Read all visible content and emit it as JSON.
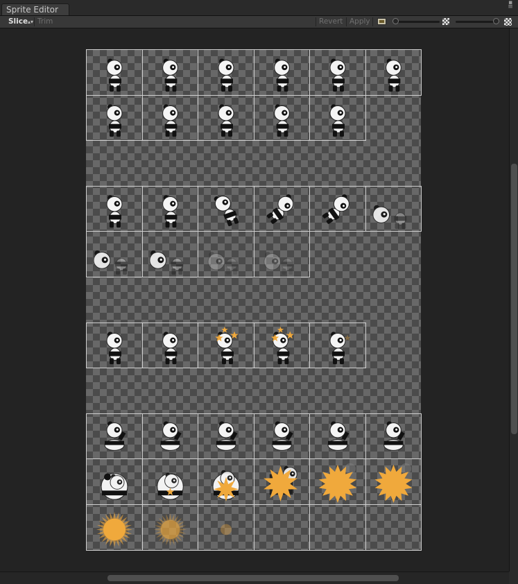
{
  "window": {
    "tab_title": "Sprite Editor"
  },
  "toolbar": {
    "slice_label": "Slice",
    "slice_dropdown_icon": "up-down-arrows-icon",
    "trim_label": "Trim",
    "revert_label": "Revert",
    "apply_label": "Apply",
    "channel_icon": "rgb-channel-icon",
    "mip_small_icon": "mip-small-icon",
    "mip_large_icon": "mip-large-icon"
  },
  "colors": {
    "window_bg": "#151515",
    "toolbar_bg": "#383838",
    "viewport_bg": "#232323",
    "checker_dark": "#4b4b4b",
    "checker_light": "#686868",
    "frame_border": "#d0d0d0",
    "star_orange": "#f0a93c"
  },
  "sprite_sheet": {
    "sprites": [
      {
        "row": 0,
        "col": 0,
        "kind": "panda-walk"
      },
      {
        "row": 0,
        "col": 1,
        "kind": "panda-walk"
      },
      {
        "row": 0,
        "col": 2,
        "kind": "panda-walk"
      },
      {
        "row": 0,
        "col": 3,
        "kind": "panda-walk"
      },
      {
        "row": 0,
        "col": 4,
        "kind": "panda-walk"
      },
      {
        "row": 0,
        "col": 5,
        "kind": "panda-walk"
      },
      {
        "row": 1,
        "col": 0,
        "kind": "panda-walk"
      },
      {
        "row": 1,
        "col": 1,
        "kind": "panda-walk"
      },
      {
        "row": 1,
        "col": 2,
        "kind": "panda-walk"
      },
      {
        "row": 1,
        "col": 3,
        "kind": "panda-walk"
      },
      {
        "row": 1,
        "col": 4,
        "kind": "panda-walk"
      },
      {
        "row": 3,
        "col": 0,
        "kind": "panda-walk"
      },
      {
        "row": 3,
        "col": 1,
        "kind": "panda-walk"
      },
      {
        "row": 3,
        "col": 2,
        "kind": "panda-tilt"
      },
      {
        "row": 3,
        "col": 3,
        "kind": "panda-fall"
      },
      {
        "row": 3,
        "col": 4,
        "kind": "panda-fall"
      },
      {
        "row": 3,
        "col": 5,
        "kind": "panda-fade"
      },
      {
        "row": 4,
        "col": 0,
        "kind": "panda-fade"
      },
      {
        "row": 4,
        "col": 1,
        "kind": "panda-fade"
      },
      {
        "row": 4,
        "col": 2,
        "kind": "panda-faint"
      },
      {
        "row": 4,
        "col": 3,
        "kind": "panda-faint"
      },
      {
        "row": 6,
        "col": 0,
        "kind": "panda-walk"
      },
      {
        "row": 6,
        "col": 1,
        "kind": "panda-walk"
      },
      {
        "row": 6,
        "col": 2,
        "kind": "panda-stars"
      },
      {
        "row": 6,
        "col": 3,
        "kind": "panda-stars"
      },
      {
        "row": 6,
        "col": 4,
        "kind": "panda-dizzy"
      },
      {
        "row": 8,
        "col": 0,
        "kind": "panda-sit"
      },
      {
        "row": 8,
        "col": 1,
        "kind": "panda-sit"
      },
      {
        "row": 8,
        "col": 2,
        "kind": "panda-sit"
      },
      {
        "row": 8,
        "col": 3,
        "kind": "panda-sit"
      },
      {
        "row": 8,
        "col": 4,
        "kind": "panda-sit"
      },
      {
        "row": 8,
        "col": 5,
        "kind": "panda-sit"
      },
      {
        "row": 9,
        "col": 0,
        "kind": "panda-round"
      },
      {
        "row": 9,
        "col": 1,
        "kind": "panda-round-star"
      },
      {
        "row": 9,
        "col": 2,
        "kind": "panda-round-star-big"
      },
      {
        "row": 9,
        "col": 3,
        "kind": "explosion-panda"
      },
      {
        "row": 9,
        "col": 4,
        "kind": "explosion"
      },
      {
        "row": 9,
        "col": 5,
        "kind": "explosion"
      },
      {
        "row": 10,
        "col": 0,
        "kind": "burst"
      },
      {
        "row": 10,
        "col": 1,
        "kind": "burst-faded"
      },
      {
        "row": 10,
        "col": 2,
        "kind": "burst-tiny"
      },
      {
        "row": 10,
        "col": 3,
        "kind": "empty"
      },
      {
        "row": 10,
        "col": 4,
        "kind": "empty"
      },
      {
        "row": 10,
        "col": 5,
        "kind": "empty"
      }
    ]
  }
}
